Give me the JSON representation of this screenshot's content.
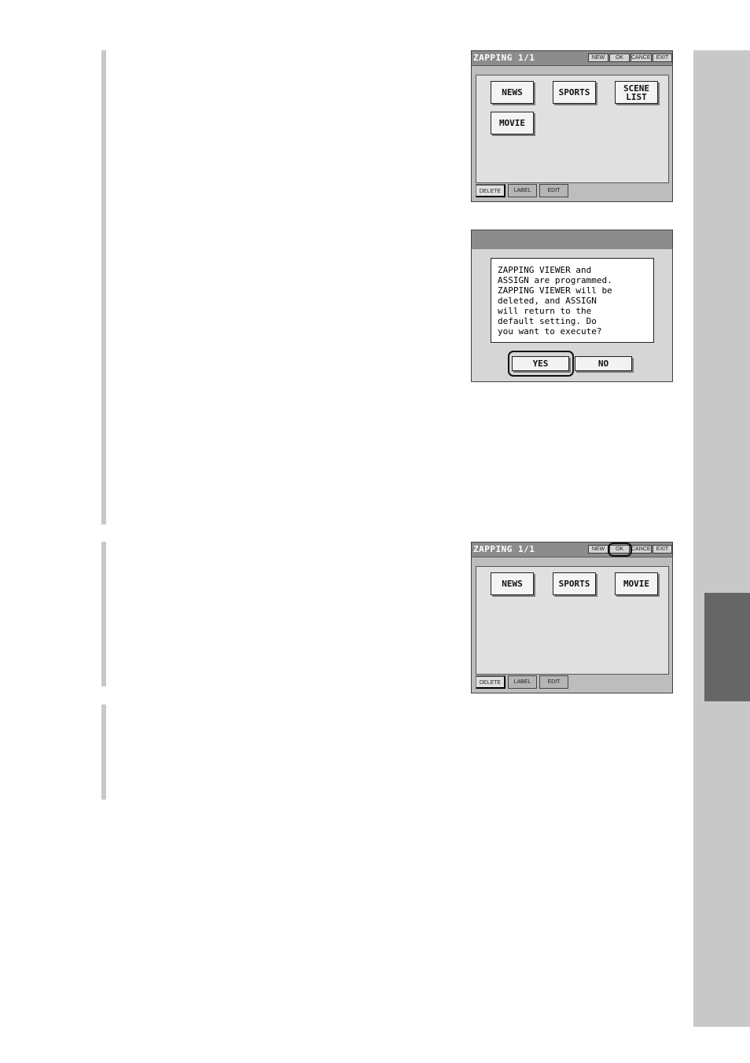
{
  "screen_a": {
    "title": "ZAPPING 1/1",
    "toolbar": {
      "new": "NEW",
      "ok": "OK",
      "cancel": "CANCEL",
      "exit": "EXIT"
    },
    "buttons": [
      "NEWS",
      "SPORTS",
      "SCENE\nLIST",
      "MOVIE"
    ],
    "tabs": [
      "DELETE",
      "LABEL",
      "EDIT"
    ]
  },
  "dialog": {
    "message": "ZAPPING VIEWER and\nASSIGN are programmed.\nZAPPING VIEWER will be\ndeleted, and ASSIGN\nwill return to the\ndefault setting. Do\nyou want to execute?",
    "yes": "YES",
    "no": "NO"
  },
  "screen_b": {
    "title": "ZAPPING 1/1",
    "toolbar": {
      "new": "NEW",
      "ok": "OK",
      "cancel": "CANCEL",
      "exit": "EXIT"
    },
    "buttons": [
      "NEWS",
      "SPORTS",
      "MOVIE"
    ],
    "tabs": [
      "DELETE",
      "LABEL",
      "EDIT"
    ]
  }
}
